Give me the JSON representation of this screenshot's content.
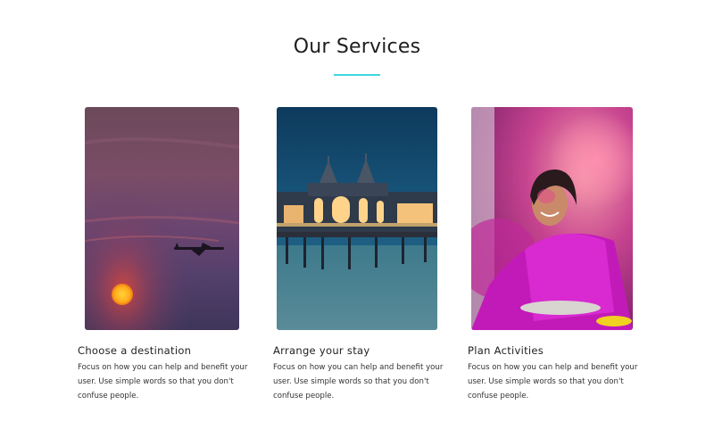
{
  "section": {
    "title": "Our Services"
  },
  "accent_color": "#3fd6e0",
  "cards": [
    {
      "title": "Choose a destination",
      "text": "Focus on how you can help and benefit your user. Use simple words so that you don't confuse people.",
      "image": "sunset-airplane-image"
    },
    {
      "title": "Arrange your stay",
      "text": "Focus on how you can help and benefit your user. Use simple words so that you don't confuse people.",
      "image": "pier-hotel-night-image"
    },
    {
      "title": "Plan Activities",
      "text": "Focus on how you can help and benefit your user. Use simple words so that you don't confuse people.",
      "image": "holi-festival-woman-image"
    }
  ]
}
